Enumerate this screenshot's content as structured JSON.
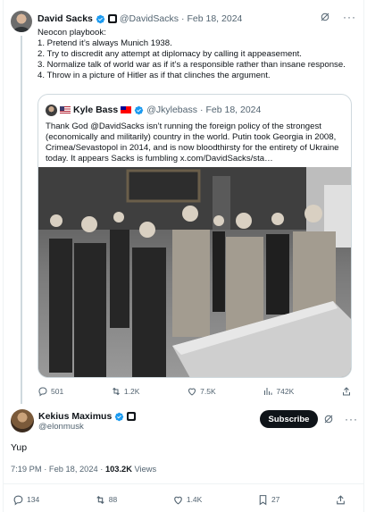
{
  "post": {
    "author_name": "David Sacks",
    "handle": "@DavidSacks",
    "separator": "·",
    "date": "Feb 18, 2024",
    "lines": [
      "Neocon playbook:",
      "1. Pretend it’s always Munich 1938.",
      "2. Try to discredit any attempt at diplomacy by calling it appeasement.",
      "3. Normalize talk of world war as if it’s a responsible rather than insane response.",
      "4. Throw in a picture of Hitler as if that clinches the argument."
    ],
    "quote": {
      "author_name": "Kyle Bass",
      "handle": "@Jkylebass",
      "separator": "·",
      "date": "Feb 18, 2024",
      "text": "Thank God @DavidSacks isn’t running the foreign policy of the strongest (economically and militarily) country in the world. Putin took Georgia in 2008, Crimea/Sevastopol in 2014, and is now bloodthirsty for the entirety of Ukraine today. It appears Sacks is fumbling  x.com/DavidSacks/sta…"
    },
    "metrics": {
      "replies": "501",
      "reposts": "1.2K",
      "likes": "7.5K",
      "views": "742K"
    }
  },
  "reply": {
    "author_name": "Kekius Maximus",
    "handle": "@elonmusk",
    "subscribe_label": "Subscribe",
    "text": "Yup",
    "time": "7:19 PM · Feb 18, 2024 · ",
    "views_count": "103.2K",
    "views_label": " Views",
    "metrics": {
      "replies": "134",
      "reposts": "88",
      "likes": "1.4K",
      "bookmarks": "27"
    }
  },
  "colors": {
    "verified": "#1d9bf0",
    "muted": "#536471",
    "text": "#0f1419",
    "border": "#cfd9de"
  },
  "icons": [
    "verified-badge-icon",
    "grok-icon",
    "more-icon",
    "reply-icon",
    "repost-icon",
    "like-icon",
    "views-icon",
    "bookmark-icon",
    "share-icon"
  ]
}
